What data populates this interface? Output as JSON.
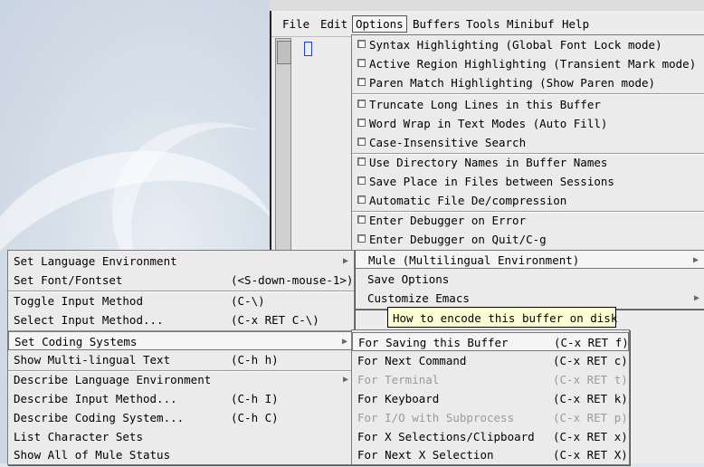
{
  "menubar": {
    "items": [
      "File",
      "Edit",
      "Options",
      "Buffers",
      "Tools",
      "Minibuf",
      "Help"
    ]
  },
  "options_menu": {
    "items": [
      "Syntax Highlighting (Global Font Lock mode)",
      "Active Region Highlighting (Transient Mark mode)",
      "Paren Match Highlighting (Show Paren mode)",
      "Truncate Long Lines in this Buffer",
      "Word Wrap in Text Modes (Auto Fill)",
      "Case-Insensitive Search",
      "Use Directory Names in Buffer Names",
      "Save Place in Files between Sessions",
      "Automatic File De/compression",
      "Enter Debugger on Error",
      "Enter Debugger on Quit/C-g"
    ],
    "mule": "Mule (Multilingual Environment)",
    "save_options": "Save Options",
    "customize": "Customize Emacs"
  },
  "tooltip": "How to encode this buffer on disk",
  "mule_menu": {
    "items": [
      {
        "label": "Set Language Environment",
        "key": "",
        "arrow": true
      },
      {
        "label": "Set Font/Fontset",
        "key": "(<S-down-mouse-1>)"
      },
      {
        "label": "Toggle Input Method",
        "key": "(C-\\)"
      },
      {
        "label": "Select Input Method...",
        "key": "(C-x RET C-\\)"
      },
      {
        "label": "Set Coding Systems",
        "key": "",
        "arrow": true
      },
      {
        "label": "Show Multi-lingual Text",
        "key": "(C-h h)"
      },
      {
        "label": "Describe Language Environment",
        "key": "",
        "arrow": true
      },
      {
        "label": "Describe Input Method...",
        "key": "(C-h I)"
      },
      {
        "label": "Describe Coding System...",
        "key": "(C-h C)"
      },
      {
        "label": "List Character Sets",
        "key": ""
      },
      {
        "label": "Show All of Mule Status",
        "key": ""
      }
    ]
  },
  "coding_menu": {
    "items": [
      {
        "label": "For Saving this Buffer",
        "key": "(C-x RET f)"
      },
      {
        "label": "For Next Command",
        "key": "(C-x RET c)"
      },
      {
        "label": "For Terminal",
        "key": "(C-x RET t)"
      },
      {
        "label": "For Keyboard",
        "key": "(C-x RET k)"
      },
      {
        "label": "For I/O with Subprocess",
        "key": "(C-x RET p)"
      },
      {
        "label": "For X Selections/Clipboard",
        "key": "(C-x RET x)"
      },
      {
        "label": "For Next X Selection",
        "key": "(C-x RET X)"
      }
    ]
  }
}
